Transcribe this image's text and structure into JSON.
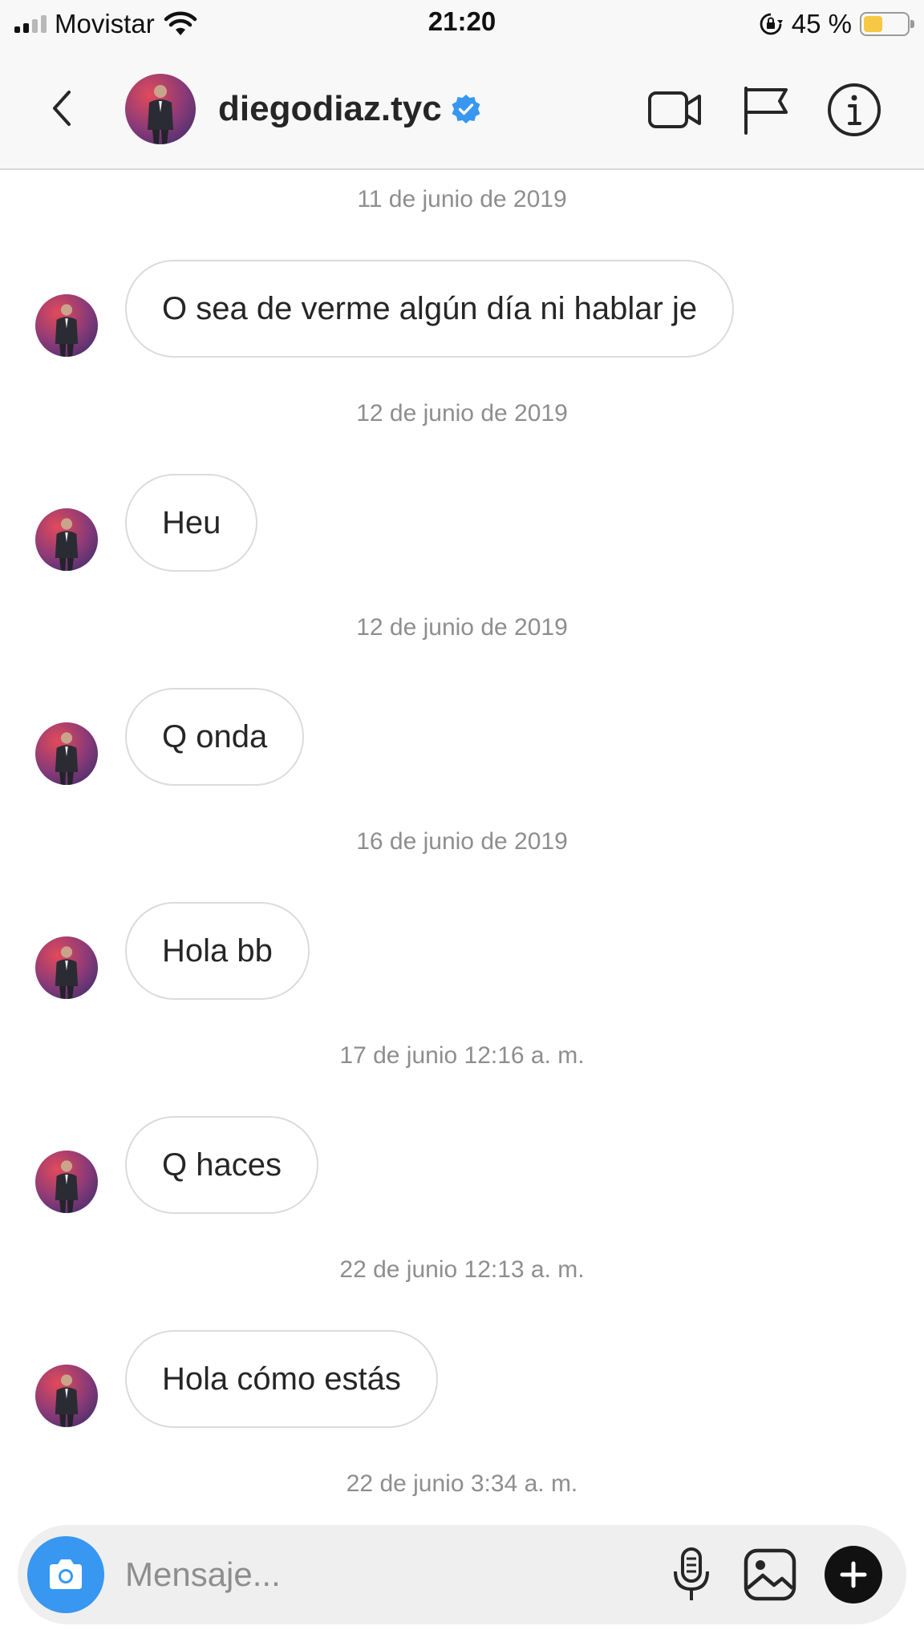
{
  "status_bar": {
    "carrier": "Movistar",
    "time": "21:20",
    "battery_percent": "45 %",
    "battery_level": 0.45
  },
  "header": {
    "username": "diegodiaz.tyc",
    "verified": true,
    "icons": [
      "back-icon",
      "video-call-icon",
      "flag-icon",
      "info-icon"
    ]
  },
  "messages": [
    {
      "date": "11 de junio de 2019",
      "text": "O sea de verme algún día ni hablar je"
    },
    {
      "date": "12 de junio de 2019",
      "text": "Heu"
    },
    {
      "date": "12 de junio de 2019",
      "text": "Q onda"
    },
    {
      "date": "16 de junio de 2019",
      "text": "Hola bb"
    },
    {
      "date": "17 de junio 12:16 a. m.",
      "text": "Q haces"
    },
    {
      "date": "22 de junio 12:13 a. m.",
      "text": "Hola cómo estás"
    },
    {
      "date": "22 de junio 3:34 a. m."
    }
  ],
  "composer": {
    "placeholder": "Mensaje...",
    "value": "",
    "icons": [
      "camera-icon",
      "microphone-icon",
      "gallery-icon",
      "plus-icon"
    ]
  },
  "colors": {
    "accent": "#3897f0",
    "verified": "#3897f0",
    "bubble_border": "#dbdbdb",
    "date_text": "#8e8e8e",
    "battery_fill": "#f7c843"
  }
}
